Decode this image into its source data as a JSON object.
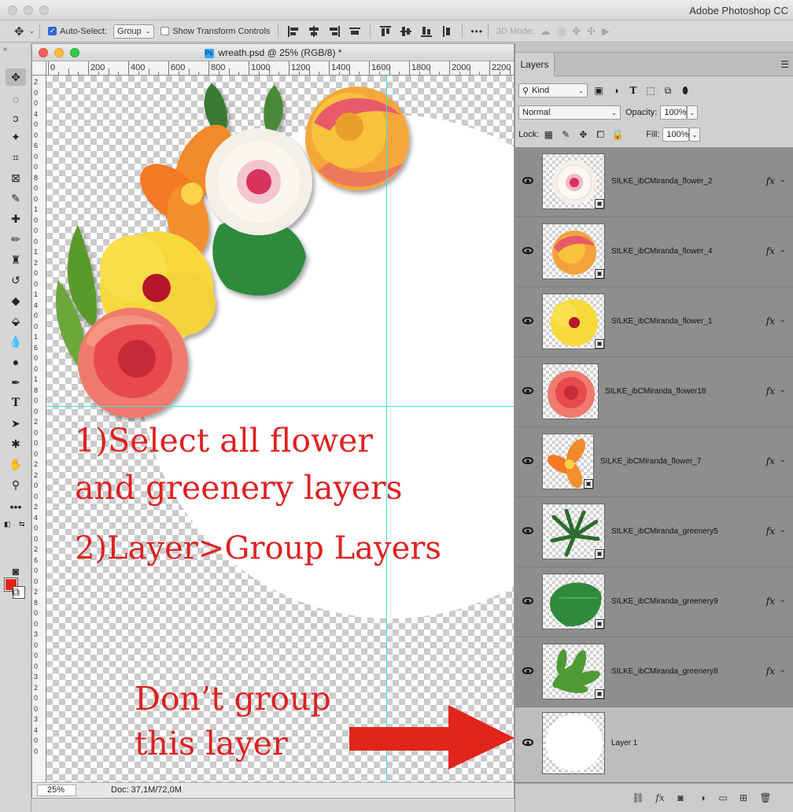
{
  "app": {
    "title": "Adobe Photoshop CC"
  },
  "options_bar": {
    "auto_select_label": "Auto-Select:",
    "auto_select_checked": true,
    "auto_select_target": "Group",
    "show_transform_label": "Show Transform Controls",
    "show_transform_checked": false,
    "more_label": "•••",
    "mode_3d_label": "3D Mode:"
  },
  "document": {
    "title": "wreath.psd @ 25% (RGB/8) *",
    "ruler_top": [
      "0",
      "200",
      "400",
      "600",
      "800",
      "1000",
      "1200",
      "1400",
      "1600",
      "1800",
      "2000",
      "2200"
    ],
    "ruler_left": [
      "2",
      "0",
      "0",
      "4",
      "0",
      "0",
      "6",
      "0",
      "0",
      "8",
      "0",
      "0",
      "1",
      "0",
      "0",
      "0",
      "1",
      "2",
      "0",
      "0",
      "1",
      "4",
      "0",
      "0",
      "1",
      "6",
      "0",
      "0",
      "1",
      "8",
      "0",
      "0",
      "2",
      "0",
      "0",
      "0",
      "2",
      "2",
      "0",
      "0",
      "2",
      "4",
      "0",
      "0",
      "2",
      "6",
      "0",
      "0",
      "2",
      "8",
      "0",
      "0",
      "3",
      "0",
      "0",
      "0",
      "3",
      "2",
      "0",
      "0",
      "3",
      "4",
      "0",
      "0"
    ],
    "zoom": "25%",
    "doc_info": "Doc: 37,1M/72,0M"
  },
  "annotations": {
    "step1_line1": "1)Select all flower",
    "step1_line2": "and greenery layers",
    "step2": "2)Layer>Group Layers",
    "note_line1": "Don’t group",
    "note_line2": "this layer"
  },
  "colors": {
    "annotation_red": "#e02020",
    "guide_cyan": "#3fe0e8",
    "foreground": "#e1251b",
    "background": "#ffffff"
  },
  "layers_panel": {
    "tab": "Layers",
    "filter_kind": "Kind",
    "blend_mode": "Normal",
    "opacity_label": "Opacity:",
    "opacity_value": "100%",
    "lock_label": "Lock:",
    "fill_label": "Fill:",
    "fill_value": "100%",
    "layers": [
      {
        "name": "SILKE_ibCMiranda_flower_2",
        "fx": "fx",
        "thumb": "dahlia"
      },
      {
        "name": "SILKE_ibCMiranda_flower_4",
        "fx": "fx",
        "thumb": "rose"
      },
      {
        "name": "SILKE_ibCMiranda_flower_1",
        "fx": "fx",
        "thumb": "hibiscus"
      },
      {
        "name": "SILKE_ibCMiranda_flower18",
        "fx": "fx",
        "thumb": "pink-flower"
      },
      {
        "name": "SILKE_ibCMiranda_flower_7",
        "fx": "fx",
        "thumb": "plumeria"
      },
      {
        "name": "SILKE_ibCMiranda_greenery5",
        "fx": "fx",
        "thumb": "palm-leaf"
      },
      {
        "name": "SILKE_ibCMiranda_greenery9",
        "fx": "fx",
        "thumb": "big-leaf"
      },
      {
        "name": "SILKE_ibCMiranda_greenery8",
        "fx": "fx",
        "thumb": "fern-leaf"
      },
      {
        "name": "Layer 1",
        "fx": "",
        "thumb": "white-circle"
      }
    ]
  }
}
